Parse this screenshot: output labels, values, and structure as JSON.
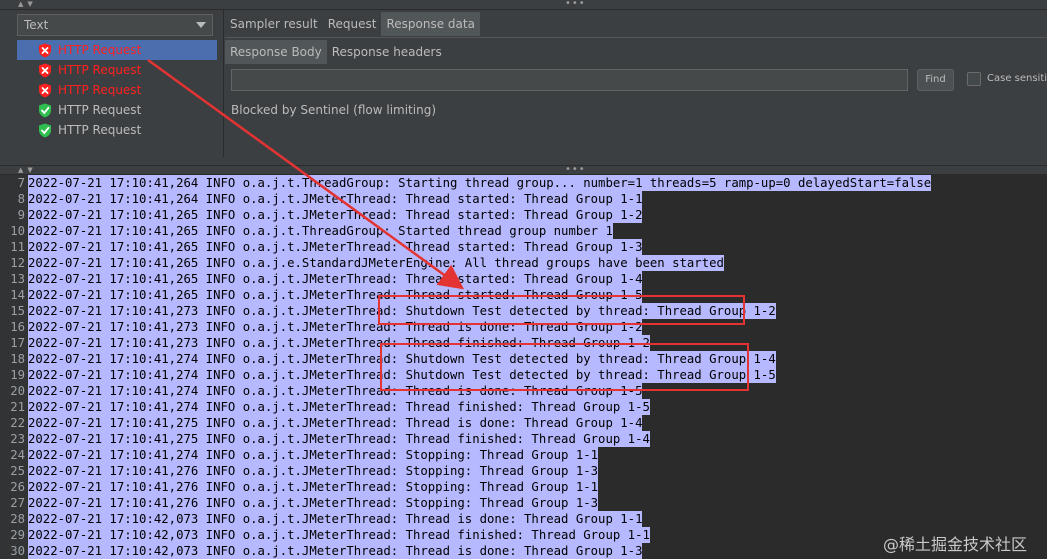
{
  "view_selector": {
    "value": "Text"
  },
  "samples": [
    {
      "label": "HTTP Request",
      "status": "fail",
      "selected": true
    },
    {
      "label": "HTTP Request",
      "status": "fail",
      "selected": false
    },
    {
      "label": "HTTP Request",
      "status": "fail",
      "selected": false
    },
    {
      "label": "HTTP Request",
      "status": "ok",
      "selected": false
    },
    {
      "label": "HTTP Request",
      "status": "ok",
      "selected": false
    }
  ],
  "result_tabs": [
    "Sampler result",
    "Request",
    "Response data"
  ],
  "active_result_tab": "Response data",
  "response_tabs": [
    "Response Body",
    "Response headers"
  ],
  "active_response_tab": "Response Body",
  "search": {
    "value": "",
    "find_label": "Find",
    "case_label": "Case sensitive"
  },
  "response_body": "Blocked by Sentinel (flow limiting)",
  "log": [
    {
      "n": "7",
      "text": "2022-07-21 17:10:41,264 INFO o.a.j.t.ThreadGroup: Starting thread group... number=1 threads=5 ramp-up=0 delayedStart=false"
    },
    {
      "n": "8",
      "text": "2022-07-21 17:10:41,264 INFO o.a.j.t.JMeterThread: Thread started: Thread Group 1-1"
    },
    {
      "n": "9",
      "text": "2022-07-21 17:10:41,265 INFO o.a.j.t.JMeterThread: Thread started: Thread Group 1-2"
    },
    {
      "n": "10",
      "text": "2022-07-21 17:10:41,265 INFO o.a.j.t.ThreadGroup: Started thread group number 1"
    },
    {
      "n": "11",
      "text": "2022-07-21 17:10:41,265 INFO o.a.j.t.JMeterThread: Thread started: Thread Group 1-3"
    },
    {
      "n": "12",
      "text": "2022-07-21 17:10:41,265 INFO o.a.j.e.StandardJMeterEngine: All thread groups have been started"
    },
    {
      "n": "13",
      "text": "2022-07-21 17:10:41,265 INFO o.a.j.t.JMeterThread: Thread started: Thread Group 1-4"
    },
    {
      "n": "14",
      "text": "2022-07-21 17:10:41,265 INFO o.a.j.t.JMeterThread: Thread started: Thread Group 1-5"
    },
    {
      "n": "15",
      "text": "2022-07-21 17:10:41,273 INFO o.a.j.t.JMeterThread: Shutdown Test detected by thread: Thread Group 1-2"
    },
    {
      "n": "16",
      "text": "2022-07-21 17:10:41,273 INFO o.a.j.t.JMeterThread: Thread is done: Thread Group 1-2"
    },
    {
      "n": "17",
      "text": "2022-07-21 17:10:41,273 INFO o.a.j.t.JMeterThread: Thread finished: Thread Group 1-2"
    },
    {
      "n": "18",
      "text": "2022-07-21 17:10:41,274 INFO o.a.j.t.JMeterThread: Shutdown Test detected by thread: Thread Group 1-4"
    },
    {
      "n": "19",
      "text": "2022-07-21 17:10:41,274 INFO o.a.j.t.JMeterThread: Shutdown Test detected by thread: Thread Group 1-5"
    },
    {
      "n": "20",
      "text": "2022-07-21 17:10:41,274 INFO o.a.j.t.JMeterThread: Thread is done: Thread Group 1-5"
    },
    {
      "n": "21",
      "text": "2022-07-21 17:10:41,274 INFO o.a.j.t.JMeterThread: Thread finished: Thread Group 1-5"
    },
    {
      "n": "22",
      "text": "2022-07-21 17:10:41,275 INFO o.a.j.t.JMeterThread: Thread is done: Thread Group 1-4"
    },
    {
      "n": "23",
      "text": "2022-07-21 17:10:41,275 INFO o.a.j.t.JMeterThread: Thread finished: Thread Group 1-4"
    },
    {
      "n": "24",
      "text": "2022-07-21 17:10:41,274 INFO o.a.j.t.JMeterThread: Stopping: Thread Group 1-1"
    },
    {
      "n": "25",
      "text": "2022-07-21 17:10:41,276 INFO o.a.j.t.JMeterThread: Stopping: Thread Group 1-3"
    },
    {
      "n": "26",
      "text": "2022-07-21 17:10:41,276 INFO o.a.j.t.JMeterThread: Stopping: Thread Group 1-1"
    },
    {
      "n": "27",
      "text": "2022-07-21 17:10:41,276 INFO o.a.j.t.JMeterThread: Stopping: Thread Group 1-3"
    },
    {
      "n": "28",
      "text": "2022-07-21 17:10:42,073 INFO o.a.j.t.JMeterThread: Thread is done: Thread Group 1-1"
    },
    {
      "n": "29",
      "text": "2022-07-21 17:10:42,073 INFO o.a.j.t.JMeterThread: Thread finished: Thread Group 1-1"
    },
    {
      "n": "30",
      "text": "2022-07-21 17:10:42,073 INFO o.a.j.t.JMeterThread: Thread is done: Thread Group 1-3"
    }
  ],
  "watermark": "@稀土掘金技术社区",
  "colors": {
    "fail": "#ff2020",
    "ok": "#2fbf4f",
    "highlight": "#b6b9ff",
    "annotation": "#e33333"
  }
}
